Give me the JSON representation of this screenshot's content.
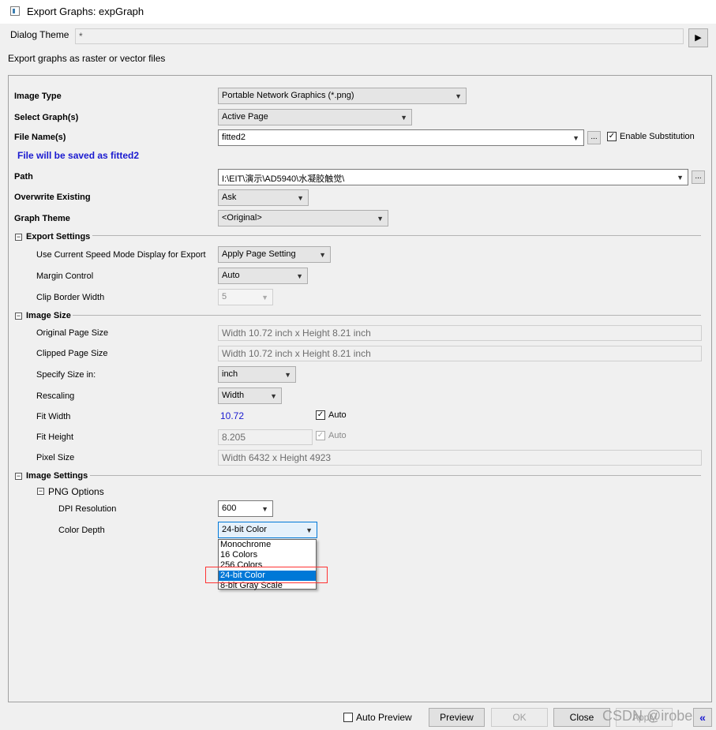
{
  "window": {
    "title": "Export Graphs: expGraph"
  },
  "theme": {
    "label": "Dialog Theme",
    "value": "*"
  },
  "description": "Export graphs as raster or vector files",
  "fields": {
    "image_type": {
      "label": "Image Type",
      "value": "Portable Network Graphics (*.png)"
    },
    "select_graphs": {
      "label": "Select Graph(s)",
      "value": "Active Page"
    },
    "file_name": {
      "label": "File Name(s)",
      "value": "fitted2",
      "browse": "...",
      "substitution_label": "Enable Substitution",
      "substitution_checked": true
    },
    "save_note": "File will be saved as fitted2",
    "path": {
      "label": "Path",
      "value": "I:\\EIT\\演示\\AD5940\\水凝胶触觉\\",
      "browse": "..."
    },
    "overwrite": {
      "label": "Overwrite Existing",
      "value": "Ask"
    },
    "graph_theme": {
      "label": "Graph Theme",
      "value": "<Original>"
    }
  },
  "export_settings": {
    "header": "Export Settings",
    "speed_mode": {
      "label": "Use Current Speed Mode Display for Export",
      "value": "Apply Page Setting"
    },
    "margin_control": {
      "label": "Margin Control",
      "value": "Auto"
    },
    "clip_border": {
      "label": "Clip Border Width",
      "value": "5"
    }
  },
  "image_size": {
    "header": "Image Size",
    "original": {
      "label": "Original Page Size",
      "value": "Width 10.72 inch x Height 8.21 inch"
    },
    "clipped": {
      "label": "Clipped Page Size",
      "value": "Width 10.72 inch x Height 8.21 inch"
    },
    "specify": {
      "label": "Specify Size in:",
      "value": "inch"
    },
    "rescaling": {
      "label": "Rescaling",
      "value": "Width"
    },
    "fit_width": {
      "label": "Fit Width",
      "value": "10.72",
      "auto_label": "Auto",
      "auto_checked": true
    },
    "fit_height": {
      "label": "Fit Height",
      "value": "8.205",
      "auto_label": "Auto",
      "auto_checked": true
    },
    "pixel_size": {
      "label": "Pixel Size",
      "value": "Width 6432 x Height 4923"
    }
  },
  "image_settings": {
    "header": "Image Settings",
    "png_header": "PNG Options",
    "dpi": {
      "label": "DPI Resolution",
      "value": "600"
    },
    "color_depth": {
      "label": "Color Depth",
      "value": "24-bit Color",
      "options": [
        "Monochrome",
        "16 Colors",
        "256 Colors",
        "24-bit Color",
        "8-bit Gray Scale"
      ],
      "selected_index": 3
    }
  },
  "footer": {
    "auto_preview": "Auto Preview",
    "preview": "Preview",
    "ok": "OK",
    "close": "Close",
    "apply": "Apply",
    "collapse": "«"
  },
  "watermark": "CSDN @irobe"
}
